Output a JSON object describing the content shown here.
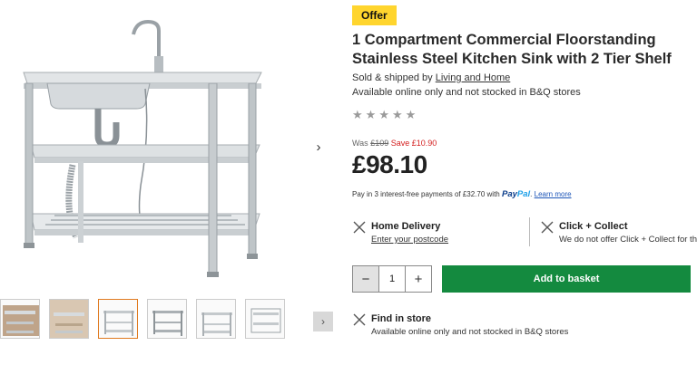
{
  "badge": "Offer",
  "title": "1 Compartment Commercial Floorstanding Stainless Steel Kitchen Sink with 2 Tier Shelf",
  "seller": {
    "prefix": "Sold & shipped by",
    "name": "Living and Home"
  },
  "availability": "Available online only and not stocked in B&Q stores",
  "rating": {
    "stars": 5,
    "filled": 0
  },
  "pricing": {
    "was_label": "Was",
    "was_price": "£109",
    "save": "Save £10.90",
    "price": "£98.10"
  },
  "paypal": {
    "text": "Pay in 3 interest-free payments of £32.70 with",
    "brand1": "Pay",
    "brand2": "Pal",
    "dot": ".",
    "learn": "Learn more"
  },
  "delivery": {
    "home": {
      "title": "Home Delivery",
      "sub": "Enter your postcode"
    },
    "collect": {
      "title": "Click + Collect",
      "sub": "We do not offer Click + Collect for this"
    }
  },
  "quantity": {
    "minus": "−",
    "value": "1",
    "plus": "+"
  },
  "add_to_basket": "Add to basket",
  "find_in_store": {
    "title": "Find in store",
    "sub": "Available online only and not stocked in B&Q stores"
  },
  "gallery": {
    "next": "›",
    "thumb_next": "›",
    "thumb_count": 6,
    "active_thumb": 3
  },
  "colors": {
    "badge": "#ffd52e",
    "save": "#d42020",
    "add_button": "#148a3f",
    "link": "#1d55b8",
    "active_thumb": "#e07a1f"
  }
}
